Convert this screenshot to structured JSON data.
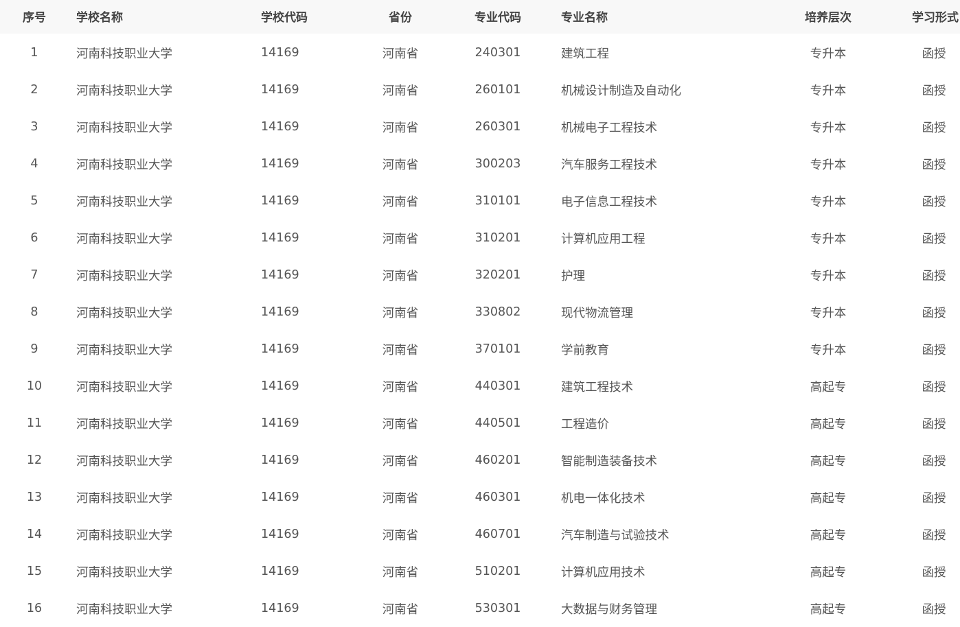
{
  "headers": {
    "index": "序号",
    "school_name": "学校名称",
    "school_code": "学校代码",
    "province": "省份",
    "major_code": "专业代码",
    "major_name": "专业名称",
    "level": "培养层次",
    "study_form": "学习形式"
  },
  "rows": [
    {
      "index": "1",
      "school_name": "河南科技职业大学",
      "school_code": "14169",
      "province": "河南省",
      "major_code": "240301",
      "major_name": "建筑工程",
      "level": "专升本",
      "study_form": "函授"
    },
    {
      "index": "2",
      "school_name": "河南科技职业大学",
      "school_code": "14169",
      "province": "河南省",
      "major_code": "260101",
      "major_name": "机械设计制造及自动化",
      "level": "专升本",
      "study_form": "函授"
    },
    {
      "index": "3",
      "school_name": "河南科技职业大学",
      "school_code": "14169",
      "province": "河南省",
      "major_code": "260301",
      "major_name": "机械电子工程技术",
      "level": "专升本",
      "study_form": "函授"
    },
    {
      "index": "4",
      "school_name": "河南科技职业大学",
      "school_code": "14169",
      "province": "河南省",
      "major_code": "300203",
      "major_name": "汽车服务工程技术",
      "level": "专升本",
      "study_form": "函授"
    },
    {
      "index": "5",
      "school_name": "河南科技职业大学",
      "school_code": "14169",
      "province": "河南省",
      "major_code": "310101",
      "major_name": "电子信息工程技术",
      "level": "专升本",
      "study_form": "函授"
    },
    {
      "index": "6",
      "school_name": "河南科技职业大学",
      "school_code": "14169",
      "province": "河南省",
      "major_code": "310201",
      "major_name": "计算机应用工程",
      "level": "专升本",
      "study_form": "函授"
    },
    {
      "index": "7",
      "school_name": "河南科技职业大学",
      "school_code": "14169",
      "province": "河南省",
      "major_code": "320201",
      "major_name": "护理",
      "level": "专升本",
      "study_form": "函授"
    },
    {
      "index": "8",
      "school_name": "河南科技职业大学",
      "school_code": "14169",
      "province": "河南省",
      "major_code": "330802",
      "major_name": "现代物流管理",
      "level": "专升本",
      "study_form": "函授"
    },
    {
      "index": "9",
      "school_name": "河南科技职业大学",
      "school_code": "14169",
      "province": "河南省",
      "major_code": "370101",
      "major_name": "学前教育",
      "level": "专升本",
      "study_form": "函授"
    },
    {
      "index": "10",
      "school_name": "河南科技职业大学",
      "school_code": "14169",
      "province": "河南省",
      "major_code": "440301",
      "major_name": "建筑工程技术",
      "level": "高起专",
      "study_form": "函授"
    },
    {
      "index": "11",
      "school_name": "河南科技职业大学",
      "school_code": "14169",
      "province": "河南省",
      "major_code": "440501",
      "major_name": "工程造价",
      "level": "高起专",
      "study_form": "函授"
    },
    {
      "index": "12",
      "school_name": "河南科技职业大学",
      "school_code": "14169",
      "province": "河南省",
      "major_code": "460201",
      "major_name": "智能制造装备技术",
      "level": "高起专",
      "study_form": "函授"
    },
    {
      "index": "13",
      "school_name": "河南科技职业大学",
      "school_code": "14169",
      "province": "河南省",
      "major_code": "460301",
      "major_name": "机电一体化技术",
      "level": "高起专",
      "study_form": "函授"
    },
    {
      "index": "14",
      "school_name": "河南科技职业大学",
      "school_code": "14169",
      "province": "河南省",
      "major_code": "460701",
      "major_name": "汽车制造与试验技术",
      "level": "高起专",
      "study_form": "函授"
    },
    {
      "index": "15",
      "school_name": "河南科技职业大学",
      "school_code": "14169",
      "province": "河南省",
      "major_code": "510201",
      "major_name": "计算机应用技术",
      "level": "高起专",
      "study_form": "函授"
    },
    {
      "index": "16",
      "school_name": "河南科技职业大学",
      "school_code": "14169",
      "province": "河南省",
      "major_code": "530301",
      "major_name": "大数据与财务管理",
      "level": "高起专",
      "study_form": "函授"
    }
  ]
}
